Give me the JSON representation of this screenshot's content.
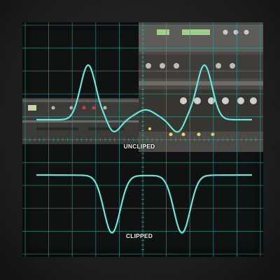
{
  "labels": {
    "upper_trace": "UNCLIPED",
    "lower_trace": "CLIPPED"
  },
  "colors": {
    "trace": "#66e6dc",
    "grid": "#2f9e97",
    "background": "#0f1211",
    "bezel": "#1f1f1f"
  },
  "screen": {
    "grid_divisions": {
      "columns": 10,
      "rows": 10
    },
    "center_axis_ticks": true
  },
  "icons": [
    "rack-equipment-image-left",
    "rack-equipment-image-right"
  ]
}
